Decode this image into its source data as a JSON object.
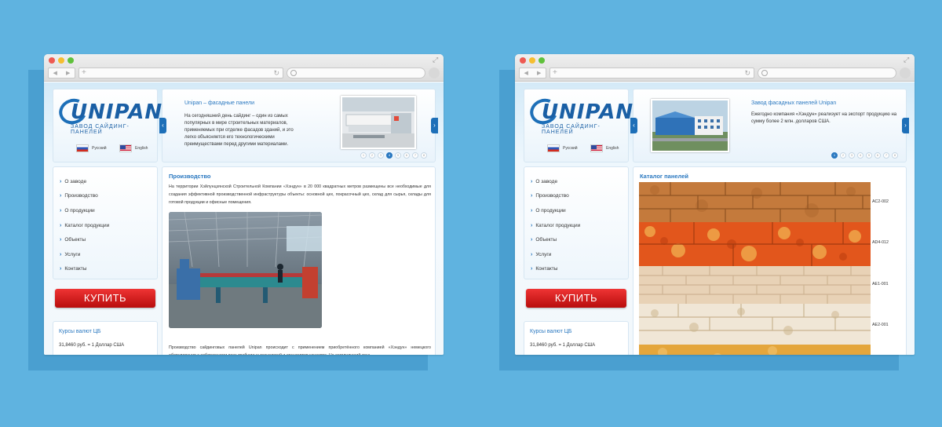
{
  "colors": {
    "background": "#5fb3e0",
    "accent": "#2a78c0",
    "buy_button": "#d21b1b"
  },
  "common": {
    "logo": "UNIPAN",
    "logo_sub": "ЗАВОД САЙДИНГ-ПАНЕЛЕЙ",
    "lang_ru": "Русский",
    "lang_en": "English",
    "menu": [
      "О заводе",
      "Производство",
      "О продукции",
      "Каталог продукции",
      "Объекты",
      "Услуги",
      "Контакты"
    ],
    "buy_label": "КУПИТЬ",
    "rates_title": "Курсы валют ЦБ",
    "rates_line": "31,8460 руб. = 1 Доллар США",
    "icons": [
      "chevron-right-icon",
      "search-icon",
      "reload-icon",
      "fullscreen-icon",
      "flag-ru-icon",
      "flag-us-icon"
    ]
  },
  "left": {
    "slider": {
      "title": "Unipan – фасадные панели",
      "text": "На сегодняшний день сайдинг – один из самых популярных в мире строительных материалов, применяемых при отделке фасадов зданий, и это легко объясняется его технологическими преимуществами перед другими материалами.",
      "dots": [
        "1",
        "2",
        "3",
        "4",
        "5",
        "6",
        "7",
        "8"
      ],
      "active_dot": 4
    },
    "content": {
      "title": "Производство",
      "para1": "На территории Хэйлунцзянской Строительной Компании «Хэндун» в 20 000 квадратных метров размещены все необходимые для создания эффективной производственной инфраструктуры объекты: основной цех, покрасочный цех, склад для сырья, склады для готовой продукции и офисные помещения.",
      "para2": "Производство сайдинговых панелей Unipan происходит с применением приобретённого компанией «Хэндун» немецкого оборудования с соблюдением всех требуемых технологий и стандартов качества. На сегодняшний день"
    }
  },
  "right": {
    "slider": {
      "title": "Завод фасадных панелей Unipan",
      "text": "Ежегодно компания «Хэндун» реализует на экспорт продукцию на сумму более 2 млн. долларов США.",
      "dots": [
        "1",
        "2",
        "3",
        "4",
        "5",
        "6",
        "7",
        "8"
      ],
      "active_dot": 1
    },
    "content": {
      "title": "Каталог панелей",
      "panels": [
        "AC2-002",
        "AD4-012",
        "AE1-001",
        "AE2-001"
      ]
    }
  }
}
